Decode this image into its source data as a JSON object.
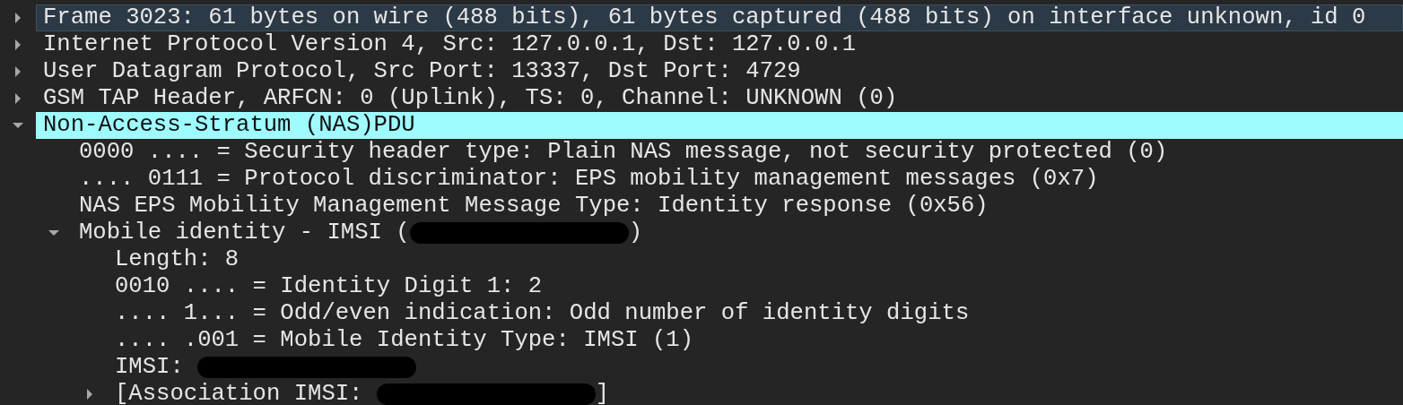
{
  "tree": [
    {
      "label": "Frame 3023: 61 bytes on wire (488 bits), 61 bytes captured (488 bits) on interface unknown, id 0",
      "expanded": false,
      "selected": false,
      "hovered": true
    },
    {
      "label": "Internet Protocol Version 4, Src: 127.0.0.1, Dst: 127.0.0.1",
      "expanded": false,
      "selected": false,
      "hovered": false
    },
    {
      "label": "User Datagram Protocol, Src Port: 13337, Dst Port: 4729",
      "expanded": false,
      "selected": false,
      "hovered": false
    },
    {
      "label": "GSM TAP Header, ARFCN: 0 (Uplink), TS: 0, Channel: UNKNOWN (0)",
      "expanded": false,
      "selected": false,
      "hovered": false
    },
    {
      "label": "Non-Access-Stratum (NAS)PDU",
      "expanded": true,
      "selected": true,
      "hovered": false,
      "children": [
        {
          "label": "0000 .... = Security header type: Plain NAS message, not security protected (0)",
          "selected": false,
          "hovered": false
        },
        {
          "label": ".... 0111 = Protocol discriminator: EPS mobility management messages (0x7)",
          "selected": false,
          "hovered": false
        },
        {
          "label": "NAS EPS Mobility Management Message Type: Identity response (0x56)",
          "selected": false,
          "hovered": false
        },
        {
          "label": "Mobile identity - IMSI (",
          "redacted": true,
          "suffix": ")",
          "expanded": true,
          "selected": false,
          "hovered": false,
          "children": [
            {
              "label": "Length: 8",
              "selected": false,
              "hovered": false
            },
            {
              "label": "0010 .... = Identity Digit 1: 2",
              "selected": false,
              "hovered": false
            },
            {
              "label": ".... 1... = Odd/even indication: Odd number of identity digits",
              "selected": false,
              "hovered": false
            },
            {
              "label": ".... .001 = Mobile Identity Type: IMSI (1)",
              "selected": false,
              "hovered": false
            },
            {
              "label": "IMSI: ",
              "redacted": true,
              "selected": false,
              "hovered": false
            },
            {
              "label": "[Association IMSI: ",
              "redacted": true,
              "suffix": "]",
              "expanded": false,
              "selected": false,
              "hovered": false
            }
          ]
        }
      ]
    }
  ]
}
